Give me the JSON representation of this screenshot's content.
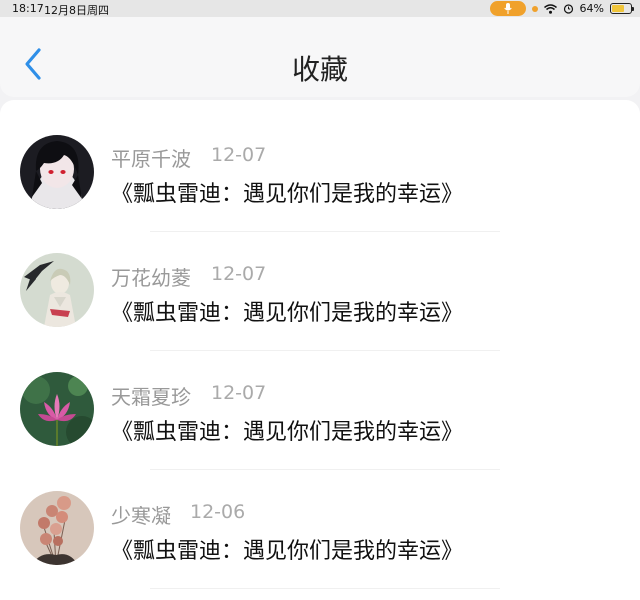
{
  "status_bar": {
    "time": "18:17",
    "date": "12月8日周四",
    "battery": "64%",
    "battery_level": 0.64
  },
  "header": {
    "title": "收藏",
    "back_icon": "chevron-left-icon"
  },
  "favorites": [
    {
      "user": "平原千波",
      "date": "12-07",
      "title": "《瓢虫雷迪：遇见你们是我的幸运》"
    },
    {
      "user": "万花幼菱",
      "date": "12-07",
      "title": "《瓢虫雷迪：遇见你们是我的幸运》"
    },
    {
      "user": "天霜夏珍",
      "date": "12-07",
      "title": "《瓢虫雷迪：遇见你们是我的幸运》"
    },
    {
      "user": "少寒凝",
      "date": "12-06",
      "title": "《瓢虫雷迪：遇见你们是我的幸运》"
    }
  ],
  "colors": {
    "accent": "#2f8fe8",
    "status_orange": "#f0a12b"
  }
}
